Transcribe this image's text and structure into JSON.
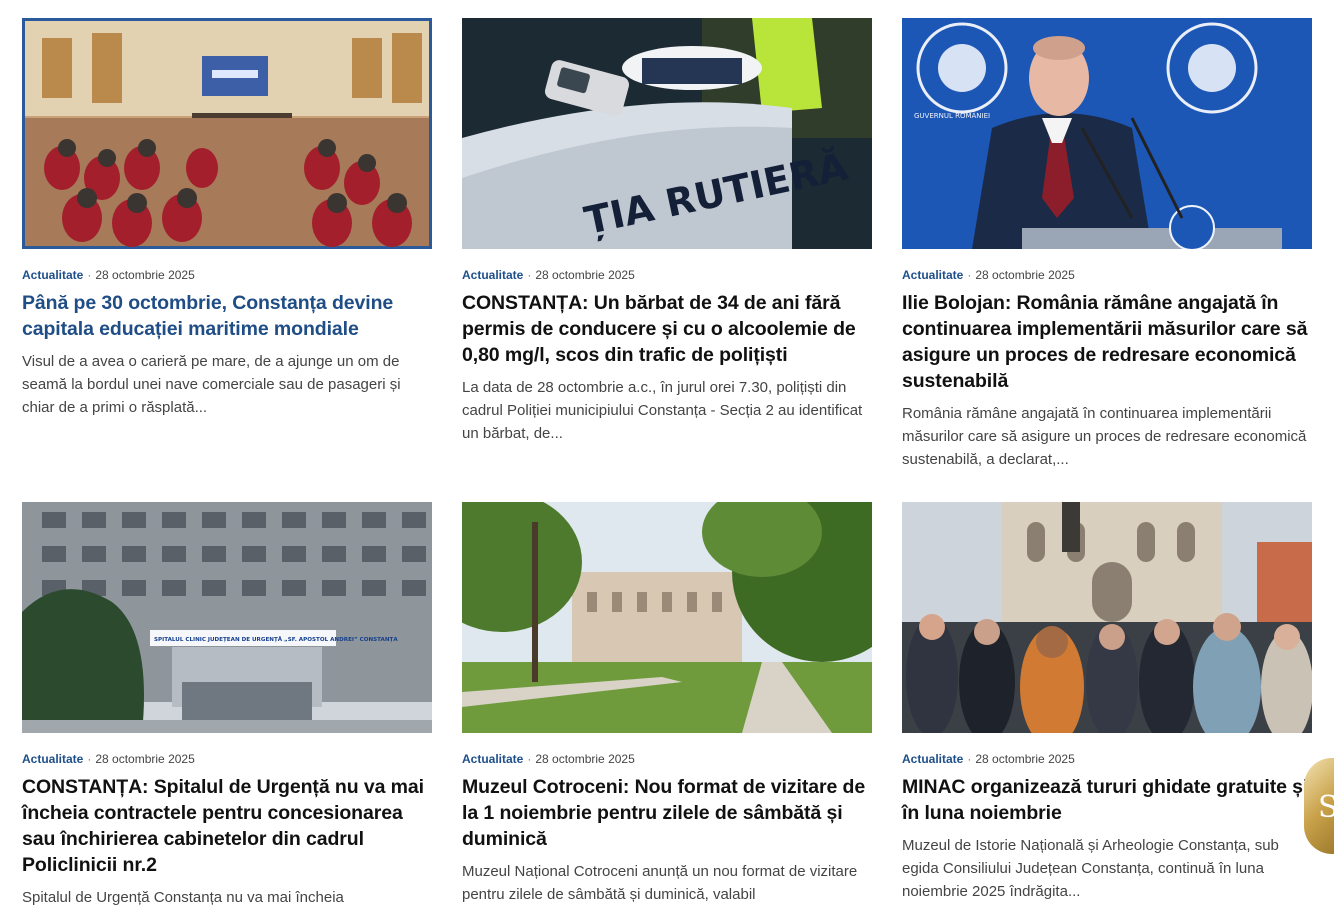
{
  "cards": [
    {
      "category": "Actualitate",
      "date": "28 octombrie 2025",
      "title": "Până pe 30 octombrie, Constanța devine capitala educației maritime mondiale",
      "excerpt": "Visul de a avea o carieră pe mare, de a ajunge un om de seamă la bordul unei nave comerciale sau de pasageri și chiar de a primi o răsplată..."
    },
    {
      "category": "Actualitate",
      "date": "28 octombrie 2025",
      "title": "CONSTANȚA: Un bărbat de 34 de ani fără permis de conducere și cu o alcoolemie de 0,80 mg/l, scos din trafic de polițiști",
      "excerpt": "La data de 28 octombrie a.c., în jurul orei 7.30, polițiști din cadrul Poliției municipiului Constanța - Secția 2 au identificat un bărbat, de...",
      "image_text": "ȚIA RUTIERĂ"
    },
    {
      "category": "Actualitate",
      "date": "28 octombrie 2025",
      "title": "Ilie Bolojan: România rămâne angajată în continuarea implementării măsurilor care să asigure un proces de redresare economică sustenabilă",
      "excerpt": "România rămâne angajată în continuarea implementării măsurilor care să asigure un proces de redresare economică sustenabilă, a declarat,...",
      "image_text": "GUVERNUL ROMÂNIEI"
    },
    {
      "category": "Actualitate",
      "date": "28 octombrie 2025",
      "title": "CONSTANȚA: Spitalul de Urgență nu va mai încheia contractele pentru concesionarea sau închirierea cabinetelor din cadrul Policlinicii nr.2",
      "excerpt": "Spitalul de Urgență Constanța nu va mai încheia",
      "image_text": "SPITALUL CLINIC JUDEȚEAN DE URGENȚĂ „SF. APOSTOL ANDREI” CONSTANȚA"
    },
    {
      "category": "Actualitate",
      "date": "28 octombrie 2025",
      "title": "Muzeul Cotroceni: Nou format de vizitare de la 1 noiembrie pentru zilele de sâmbătă și duminică",
      "excerpt": "Muzeul Național Cotroceni anunță un nou format de vizitare pentru zilele de sâmbătă și duminică, valabil"
    },
    {
      "category": "Actualitate",
      "date": "28 octombrie 2025",
      "title": "MINAC organizează tururi ghidate gratuite și în luna noiembrie",
      "excerpt": "Muzeul de Istorie Națională și Arheologie Constanța, sub egida Consiliului Județean Constanța, continuă în luna noiembrie 2025 îndrăgita..."
    }
  ],
  "separator": "·",
  "colors": {
    "category": "#1e4f8a",
    "active_title": "#1f4d85"
  }
}
